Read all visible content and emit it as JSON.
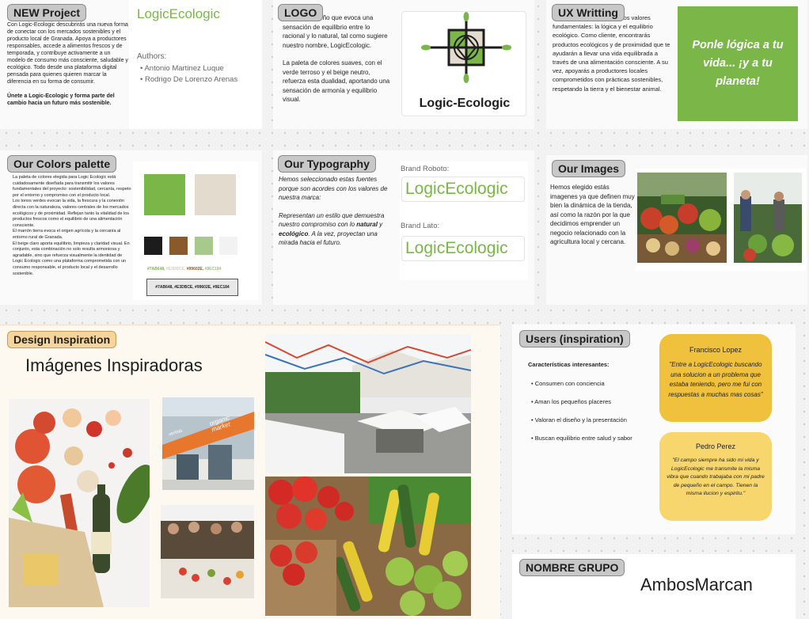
{
  "new_project": {
    "tag": "NEW Project",
    "p1": "Con Logic-Ecologic descubrirás una nueva forma de conectar con los mercados sostenibles y el producto local de Granada. Apoya a productores responsables, accede a alimentos frescos y de temporada, y contribuye activamente a un modelo de consumo más consciente, saludable y ecológico. Todo desde una plataforma digital pensada para quienes quieren marcar la diferencia en su forma de consumir.",
    "p2": "Únete a Logic-Ecologic y forma parte del cambio hacia un futuro más sostenible.",
    "brand": "LogicEcologic",
    "authors_label": "Authors:",
    "authors": [
      "Antonio Martinez Luque",
      "Rodrigo De Lorenzo Arenas"
    ]
  },
  "logo": {
    "tag": "LOGO",
    "p1": "do por un diseño que evoca una sensación de equilibrio entre lo racional y lo natural, tal como sugiere nuestro nombre, LogicEcologic.",
    "p2": "La paleta de colores suaves, con el verde terroso y el beige neutro, refuerza esta dualidad, aportando una sensación de armonía y equilibrio visual.",
    "wordmark": "Logic-Ecologic"
  },
  "ux": {
    "tag": "UX Writting",
    "p1": "ologic transmita nuestros dos valores fundamentales: la lógica y el equilibrio ecológico. Como cliente, encontrarás productos ecológicos y de proximidad que te ayudarán a llevar una vida equilibrada a través de una alimentación consciente. A su vez, apoyarás a productores locales comprometidos con prácticas sostenibles, respetando la tierra y el bienestar animal.",
    "slogan": "Ponle lógica a tu vida... ¡y a tu planeta!"
  },
  "colors": {
    "tag": "Our Colors palette",
    "p1": "La paleta de colores elegida para Logic Ecologic está cuidadosamente diseñada para transmitir los valores fundamentales del proyecto: sostenibilidad, cercanía, respeto por el entorno y compromiso con el producto local.",
    "p2": "Los tonos verdes evocan la vida, la frescura y la conexión directa con la naturaleza, valores centrales de los mercados ecológicos y de proximidad. Reflejan tanto la vitalidad de los productos frescos como el equilibrio de una alimentación consciente.",
    "p3": "El marrón tierra evoca el origen agrícola y la cercanía al entorno rural de Granada.",
    "p4": "El beige claro aporta equilibrio, limpieza y claridad visual. En conjunto, esta combinación no solo resulta armoniosa y agradable, sino que refuerza visualmente la identidad de Logic Ecologic como una plataforma comprometida con un consumo responsable, el producto local y el desarrollo sostenible.",
    "swatches_top": [
      "#7AB648",
      "#E3DBCE"
    ],
    "swatches_bottom": [
      "#1C1C1C",
      "#8B5A2B",
      "#A8C98C",
      "#F2F2F2"
    ],
    "code_colored": [
      "#7AB648,",
      "#E3DBCE,",
      "#99602E,",
      "#9EC184"
    ],
    "code_box": "#7AB648, #E3DBCE, #99602E, #9EC184"
  },
  "typography": {
    "tag": "Our Typography",
    "p1": "Hemos seleccionado estas fuentes porque son acordes con los valores de nuestra marca:",
    "p2_a": "Representan un estilo que demuestra nuestro compromiso con lo ",
    "p2_b": "natural",
    "p2_c": " y ",
    "p2_d": "ecológico",
    "p2_e": ". A la vez, proyectan una mirada hacia el futuro.",
    "roboto_label": "Brand Roboto:",
    "roboto_sample": "LogicEcologic",
    "lato_label": "Brand Lato:",
    "lato_sample": "LogicEcologic"
  },
  "images": {
    "tag": "Our Images",
    "p1": "Hemos elegido estás imagenes ya que definen muy bien la dinámica de la tienda, así como la razón por la que decidimos emprender un negocio relacionado con la agricultura local y cercana."
  },
  "design": {
    "tag": "Design Inspiration",
    "heading": "Imágenes Inspiradoras",
    "sign_text": "organic market",
    "sign_side": "veritas"
  },
  "users": {
    "tag": "Users (inspiration)",
    "heading": "Características interesantes:",
    "bullets": [
      "Consumen con conciencia",
      "Aman los pequeños placeres",
      "Valoran el diseño y la presentación",
      "Buscan equilibrio entre salud y sabor"
    ],
    "q1_name": "Francisco Lopez",
    "q1_text": "\"Entre a LogicEcologic buscando una solucion a un problema que estaba teniendo, pero me fui con respuestas a muchas mas cosas\"",
    "q2_name": "Pedro Perez",
    "q2_text": "\"El campo siempre ha sido mi vida y LogicEcologic me transmite la misma vibra que cuando trabajaba con mi padre de pequeño en el campo. Tienen la misma ilucion y espiritu.\""
  },
  "group": {
    "tag": "NOMBRE GRUPO",
    "name": "AmbosMarcan"
  }
}
